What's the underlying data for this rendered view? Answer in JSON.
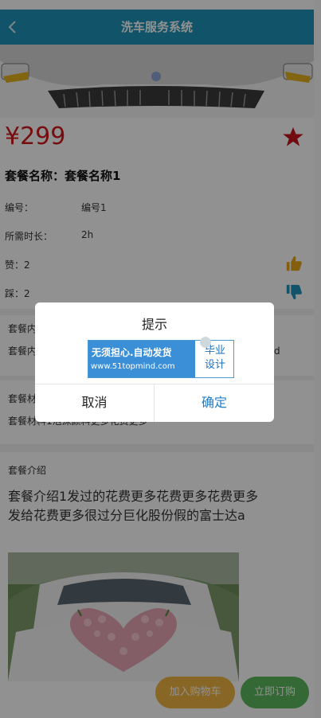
{
  "header": {
    "title": "洗车服务系统",
    "back_icon": "chevron-left-icon"
  },
  "product": {
    "price": "¥299",
    "package_name": "套餐名称：套餐名称1",
    "fields": [
      {
        "label": "编号：",
        "value": "编号1"
      },
      {
        "label": "所需时长：",
        "value": "2h"
      }
    ],
    "likes": "赞：2",
    "dislikes": "踩：2",
    "colors": {
      "price": "#d0181c",
      "star": "#c9151d",
      "thumb_up": "#e6a817",
      "thumb_down": "#1f93b8"
    }
  },
  "sections": {
    "content_label": "套餐内",
    "content_text": "套餐内",
    "content_text_tail": "分d",
    "material_label": "套餐材",
    "material_text": "套餐材料1泡沫颜料更多花费更多",
    "intro_label": "套餐介绍",
    "intro_text": "套餐介绍1发过的花费更多花费更多花费更多\n发给花费更多很过分巨化股份假的富士达a"
  },
  "actions": {
    "add_to_cart": "加入购物车",
    "order_now": "立即订购"
  },
  "dialog": {
    "title": "提示",
    "banner": {
      "line1": "无须担心.自动发货",
      "line2": "www.51topmind.com",
      "right": "毕业\n设计"
    },
    "cancel": "取消",
    "confirm": "确定"
  }
}
